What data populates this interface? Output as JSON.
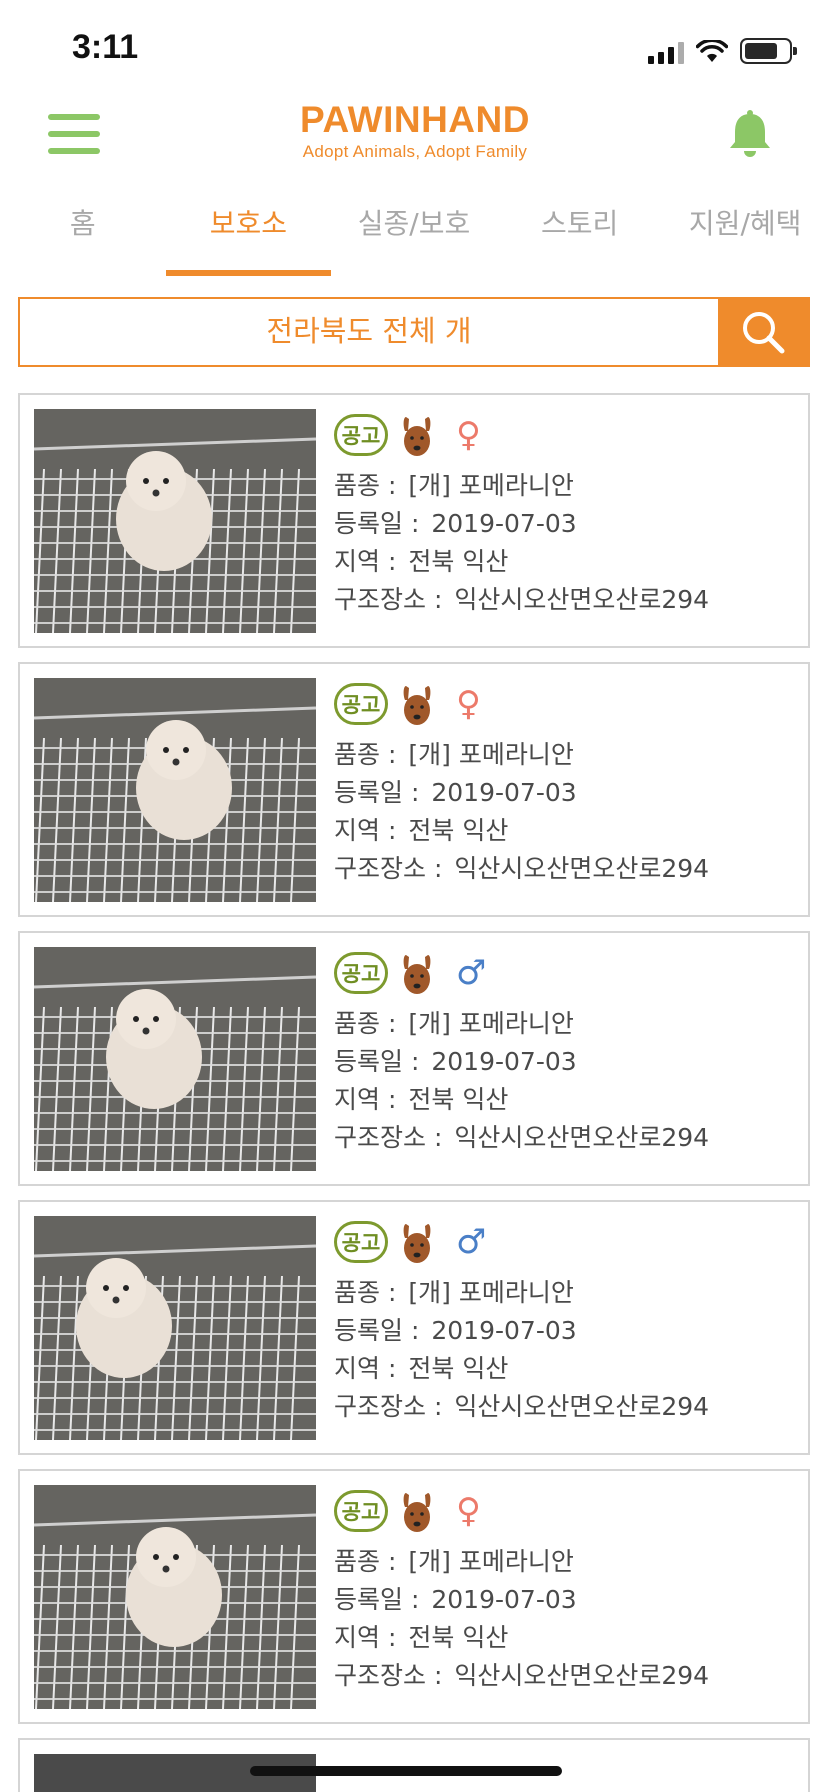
{
  "status_bar": {
    "time": "3:11"
  },
  "header": {
    "logo_title": "PAWINHAND",
    "logo_subtitle": "Adopt Animals, Adopt Family",
    "brand_color": "#ef8b2c",
    "accent_green": "#8cc766",
    "menu_icon": "hamburger-menu-icon",
    "bell_icon": "bell-icon"
  },
  "tabs": [
    {
      "label": "홈",
      "active": false
    },
    {
      "label": "보호소",
      "active": true
    },
    {
      "label": "실종/보호",
      "active": false
    },
    {
      "label": "스토리",
      "active": false
    },
    {
      "label": "지원/혜택",
      "active": false
    }
  ],
  "search": {
    "text": "전라북도 전체  개",
    "icon": "search-icon"
  },
  "labels": {
    "breed": "품종 :",
    "date": "등록일 :",
    "region": "지역 :",
    "rescue_place": "구조장소 :"
  },
  "listings": [
    {
      "notice_badge": "공고",
      "sex": "female",
      "sex_symbol": "♀",
      "breed": "[개] 포메라니안",
      "date": "2019-07-03",
      "region": "전북 익산",
      "rescue_place": "익산시오산면오산로294"
    },
    {
      "notice_badge": "공고",
      "sex": "female",
      "sex_symbol": "♀",
      "breed": "[개] 포메라니안",
      "date": "2019-07-03",
      "region": "전북 익산",
      "rescue_place": "익산시오산면오산로294"
    },
    {
      "notice_badge": "공고",
      "sex": "male",
      "sex_symbol": "♂",
      "breed": "[개] 포메라니안",
      "date": "2019-07-03",
      "region": "전북 익산",
      "rescue_place": "익산시오산면오산로294"
    },
    {
      "notice_badge": "공고",
      "sex": "male",
      "sex_symbol": "♂",
      "breed": "[개] 포메라니안",
      "date": "2019-07-03",
      "region": "전북 익산",
      "rescue_place": "익산시오산면오산로294"
    },
    {
      "notice_badge": "공고",
      "sex": "female",
      "sex_symbol": "♀",
      "breed": "[개] 포메라니안",
      "date": "2019-07-03",
      "region": "전북 익산",
      "rescue_place": "익산시오산면오산로294"
    }
  ],
  "colors": {
    "female": "#ec7a6a",
    "male": "#4a7fc7",
    "badge_green": "#6f8e22",
    "dog_icon": "#a0582a"
  }
}
